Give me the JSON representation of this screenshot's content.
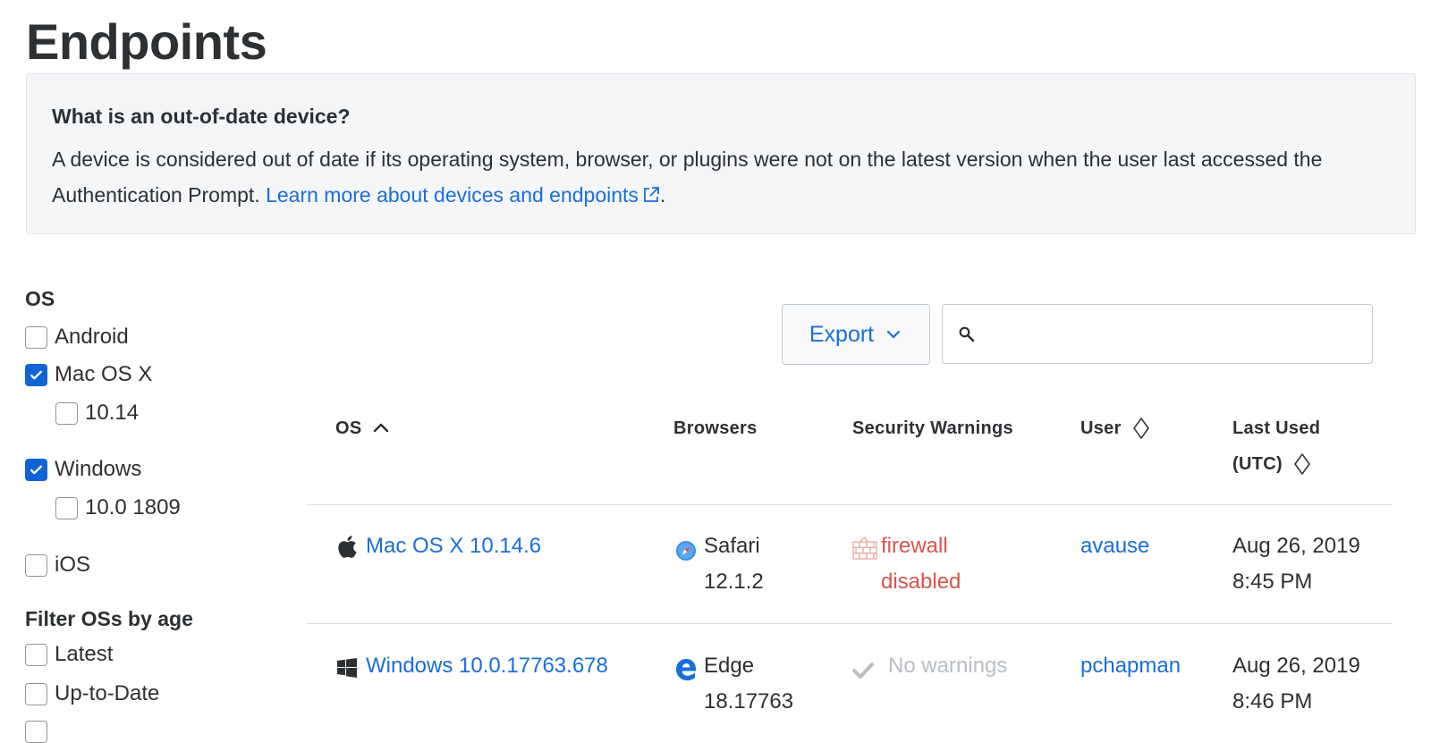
{
  "page": {
    "title": "Endpoints"
  },
  "info": {
    "heading": "What is an out-of-date device?",
    "body": "A device is considered out of date if its operating system, browser, or plugins were not on the latest version when the user last accessed the Authentication Prompt.",
    "link_text": "Learn more about devices and endpoints",
    "period": "."
  },
  "filters": {
    "os_heading": "OS",
    "os_options": [
      {
        "label": "Android",
        "checked": false
      },
      {
        "label": "Mac OS X",
        "checked": true
      },
      {
        "label": "10.14",
        "checked": false
      },
      {
        "label": "Windows",
        "checked": true
      },
      {
        "label": "10.0 1809",
        "checked": false
      },
      {
        "label": "iOS",
        "checked": false
      }
    ],
    "age_heading": "Filter OSs by age",
    "age_options": [
      {
        "label": "Latest",
        "checked": false
      },
      {
        "label": "Up-to-Date",
        "checked": false
      }
    ]
  },
  "toolbar": {
    "export_label": "Export",
    "search_placeholder": ""
  },
  "table": {
    "columns": {
      "os": "OS",
      "browsers": "Browsers",
      "security": "Security Warnings",
      "user": "User",
      "last_used_1": "Last Used",
      "last_used_2": "(UTC)"
    },
    "rows": [
      {
        "os": "Mac OS X 10.14.6",
        "os_icon": "apple-icon",
        "browser_name": "Safari",
        "browser_version": "12.1.2",
        "browser_icon": "safari-icon",
        "warning_line1": "firewall",
        "warning_line2": "disabled",
        "warning_icon": "firewall-icon",
        "user": "avause",
        "date": "Aug 26, 2019",
        "time": "8:45 PM"
      },
      {
        "os": "Windows 10.0.17763.678",
        "os_icon": "windows-icon",
        "browser_name": "Edge",
        "browser_version": "18.17763",
        "browser_icon": "edge-icon",
        "warning_line1": "No warnings",
        "warning_icon": "checkmark-icon",
        "user": "pchapman",
        "date": "Aug 26, 2019",
        "time": "8:46 PM"
      }
    ]
  },
  "colors": {
    "link": "#1a6ed8",
    "checkbox_checked": "#1064d6",
    "warning": "#d9534f"
  }
}
